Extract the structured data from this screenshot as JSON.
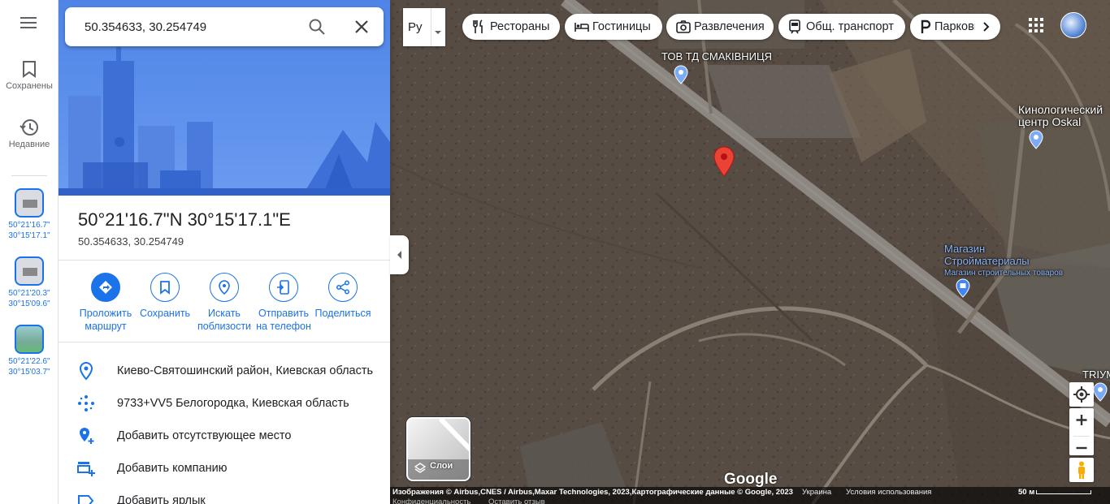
{
  "rail": {
    "saved_label": "Сохранены",
    "recent_label": "Недавние",
    "recents": [
      {
        "lat": "50°21'16.7\"",
        "lng": "30°15'17.1\""
      },
      {
        "lat": "50°21'20.3\"",
        "lng": "30°15'09.6\""
      },
      {
        "lat": "50°21'22.6\"",
        "lng": "30°15'03.7\""
      }
    ]
  },
  "search": {
    "value": "50.354633, 30.254749"
  },
  "place": {
    "title": "50°21'16.7\"N 30°15'17.1\"E",
    "subtitle": "50.354633, 30.254749"
  },
  "actions": [
    {
      "line1": "Проложить",
      "line2": "маршрут"
    },
    {
      "line1": "Сохранить",
      "line2": ""
    },
    {
      "line1": "Искать",
      "line2": "поблизости"
    },
    {
      "line1": "Отправить",
      "line2": "на телефон"
    },
    {
      "line1": "Поделиться",
      "line2": ""
    }
  ],
  "info": [
    {
      "icon": "location-pin-icon",
      "text": "Киево-Святошинский район, Киевская область"
    },
    {
      "icon": "plus-code-icon",
      "text": "9733+VV5 Белогородка, Киевская область"
    },
    {
      "icon": "add-place-icon",
      "text": "Добавить отсутствующее место"
    },
    {
      "icon": "add-business-icon",
      "text": "Добавить компанию"
    },
    {
      "icon": "label-icon",
      "text": "Добавить ярлык"
    }
  ],
  "map": {
    "lang_label": "Ру",
    "chips": [
      "Рестораны",
      "Гостиницы",
      "Развлечения",
      "Общ. транспорт",
      "Парковки"
    ],
    "labels": {
      "smakivnytsia": "ТОВ ТД СМАКІВНИЦЯ",
      "kennel_1": "Кинологический",
      "kennel_2": "центр Oskal",
      "store_1": "Магазин",
      "store_2": "Стройматериалы",
      "store_3": "Магазин строительных товаров",
      "triumph": "TRIУМ"
    },
    "layers_label": "Слои",
    "logo": "Google",
    "attribution": "Изображения © Airbus,CNES / Airbus,Maxar Technologies, 2023,Картографические данные © Google, 2023",
    "country": "Украина",
    "terms": "Условия использования",
    "scale": "50 м",
    "privacy": "Конфиденциальность",
    "feedback": "Оставить отзыв"
  },
  "colors": {
    "accent": "#1a73e8",
    "pin": "#ea4335",
    "hero": "#5b8fe8"
  }
}
